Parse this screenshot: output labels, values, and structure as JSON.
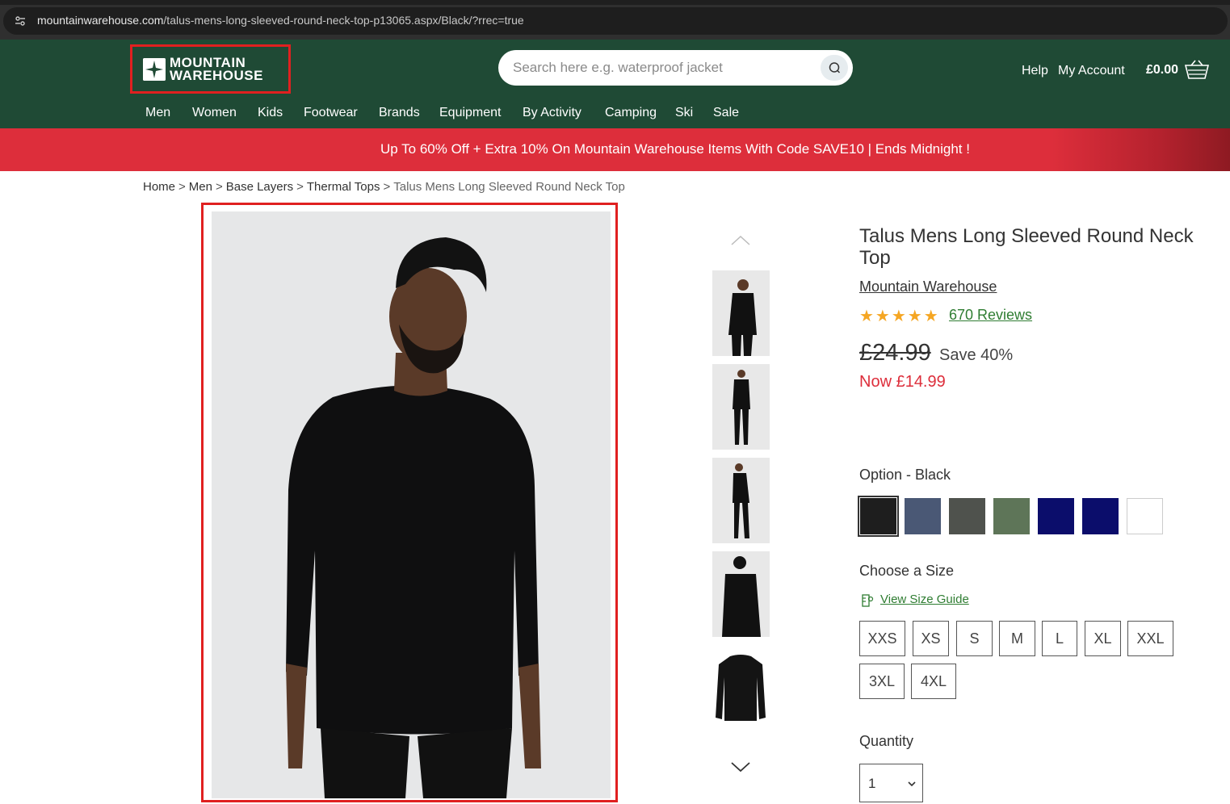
{
  "browser": {
    "url_host": "mountainwarehouse.com",
    "url_path": "/talus-mens-long-sleeved-round-neck-top-p13065.aspx/Black/?rrec=true"
  },
  "header": {
    "logo_line1": "MOUNTAIN",
    "logo_line2": "WAREHOUSE",
    "search_placeholder": "Search here e.g. waterproof jacket",
    "help": "Help",
    "account": "My Account",
    "cart_total": "£0.00"
  },
  "nav": [
    "Men",
    "Women",
    "Kids",
    "Footwear",
    "Brands",
    "Equipment",
    "By Activity",
    "Camping",
    "Ski",
    "Sale"
  ],
  "promo": "Up To 60% Off + Extra 10% On Mountain Warehouse Items With Code SAVE10 | Ends Midnight !",
  "breadcrumb": [
    "Home",
    "Men",
    "Base Layers",
    "Thermal Tops",
    "Talus Mens Long Sleeved Round Neck Top"
  ],
  "product": {
    "title": "Talus Mens Long Sleeved Round Neck Top",
    "brand": "Mountain Warehouse",
    "rating": 5,
    "reviews": "670 Reviews",
    "old_price": "£24.99",
    "save": "Save 40%",
    "now_price": "Now £14.99",
    "option_label": "Option - Black",
    "swatches": [
      "#1e1e1e",
      "#4a5875",
      "#4f524d",
      "#5e7558",
      "#0b0d6b",
      "#0b0d6b",
      "#ffffff"
    ],
    "size_label": "Choose a Size",
    "size_guide": "View Size Guide",
    "sizes": [
      "XXS",
      "XS",
      "S",
      "M",
      "L",
      "XL",
      "XXL",
      "3XL",
      "4XL"
    ],
    "quantity_label": "Quantity",
    "quantity": "1"
  },
  "colors": {
    "header_green": "#1f4a35",
    "promo_red": "#dd2e3b",
    "link_green": "#2f7d32",
    "star": "#f5a623",
    "highlight": "#e02020"
  }
}
